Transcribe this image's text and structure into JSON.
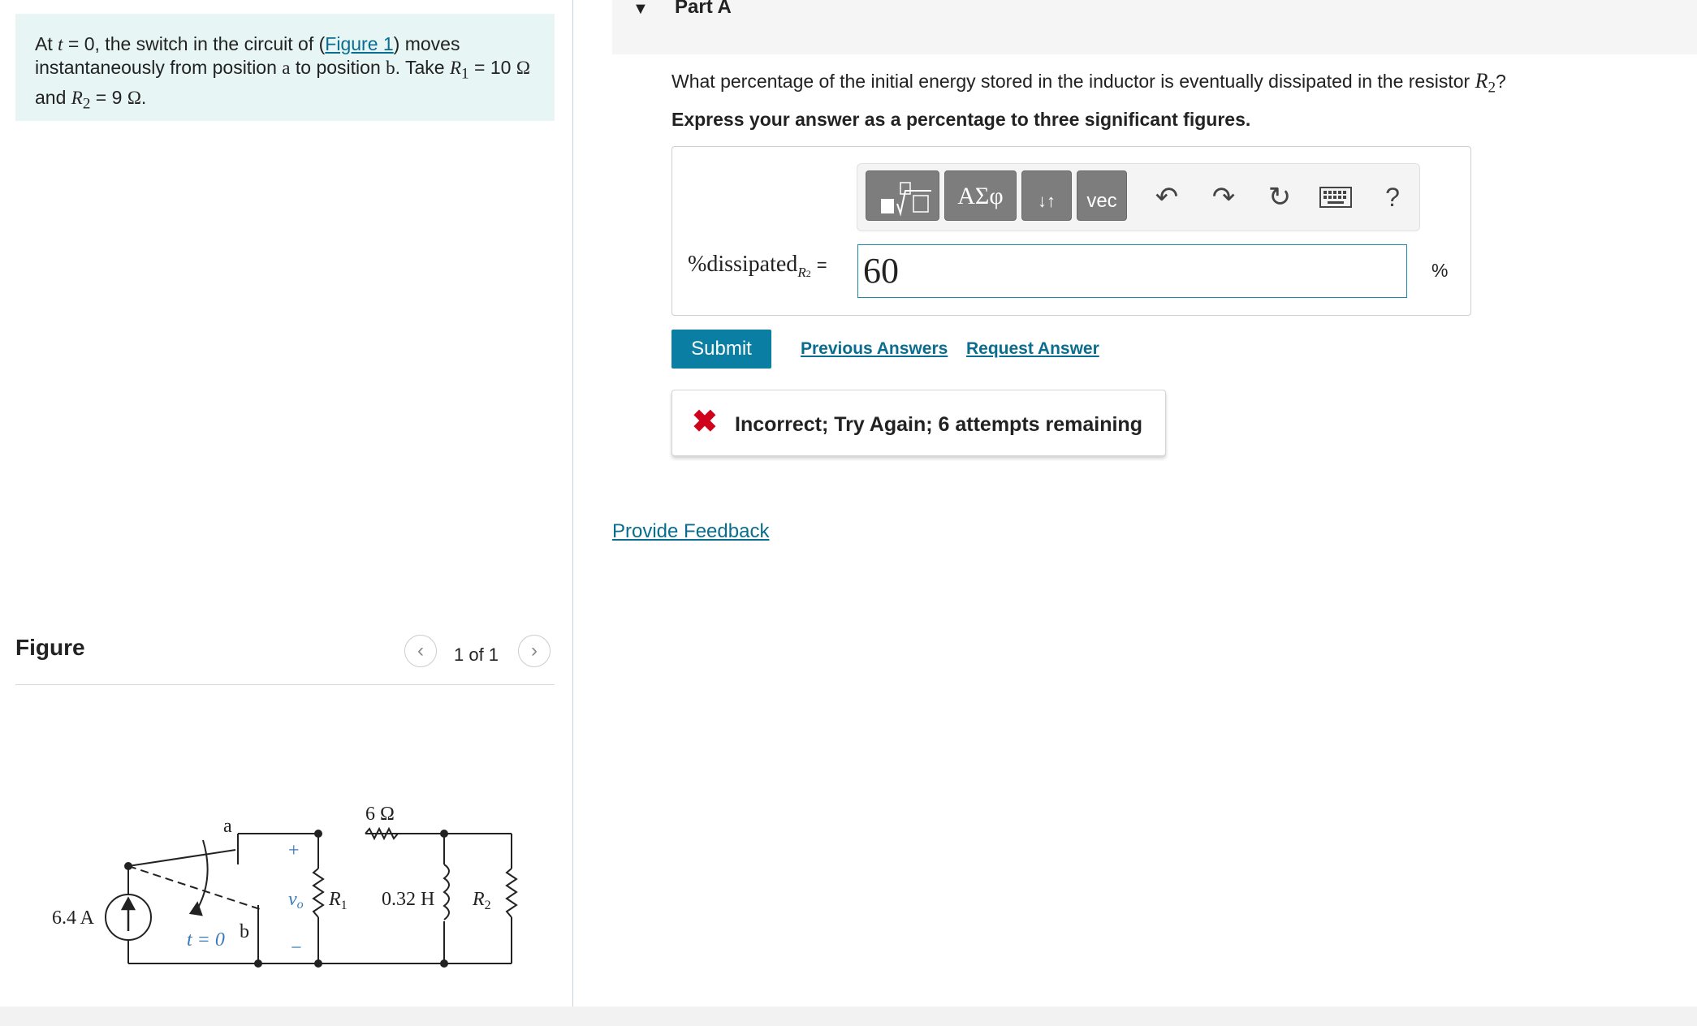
{
  "problem": {
    "text_1": "At ",
    "t_var": "t",
    "text_2": " = 0, the switch in the circuit of (",
    "figure_link": "Figure 1",
    "text_3": ") moves instantaneously from position ",
    "pos_a": "a",
    "text_4": " to position ",
    "pos_b": "b",
    "text_5": ". Take ",
    "r1_name": "R",
    "r1_sub": "1",
    "text_6": " = 10 ",
    "ohm": "Ω",
    "text_7": " and ",
    "r2_name": "R",
    "r2_sub": "2",
    "text_8": " = 9 ",
    "end": "."
  },
  "figure": {
    "title": "Figure",
    "pager": "1 of 1",
    "circuit": {
      "source": "6.4 A",
      "switch_time": "t = 0",
      "pos_a": "a",
      "pos_b": "b",
      "resistor_6": "6 Ω",
      "vo_label": "v",
      "vo_sub": "o",
      "plus": "+",
      "minus": "−",
      "r1": "R",
      "r1_sub": "1",
      "inductor": "0.32 H",
      "r2": "R",
      "r2_sub": "2"
    }
  },
  "part": {
    "title": "Part A",
    "question_text": "What percentage of the initial energy stored in the inductor is eventually dissipated in the resistor ",
    "question_var": "R",
    "question_sub": "2",
    "question_end": "?",
    "instruction": "Express your answer as a percentage to three significant figures."
  },
  "toolbar": {
    "greek": "ΑΣφ",
    "arrows": "↓↑",
    "vec": "vec",
    "help": "?"
  },
  "answer": {
    "label": "%dissipated",
    "label_sub_var": "R",
    "label_sub_num": "2",
    "equals": "=",
    "value": "60",
    "unit": "%"
  },
  "actions": {
    "submit": "Submit",
    "previous_answers": "Previous Answers",
    "request_answer": "Request Answer"
  },
  "feedback": {
    "icon": "✖",
    "text": "Incorrect; Try Again; 6 attempts remaining"
  },
  "provide_feedback": "Provide Feedback",
  "colors": {
    "accent": "#0a7ea3",
    "problem_bg": "#e8f5f5",
    "error": "#d0021b",
    "link": "#0a6d8f"
  }
}
